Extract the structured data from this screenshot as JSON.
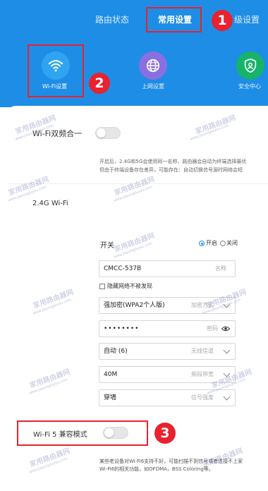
{
  "header": {
    "tabs": [
      {
        "label": "路由状态"
      },
      {
        "label": "常用设置"
      },
      {
        "label": "级设置"
      }
    ],
    "icons": [
      {
        "label": "Wi-Fi设置",
        "icon": "wifi-icon",
        "color": "#2fa4f0"
      },
      {
        "label": "上网设置",
        "icon": "globe-icon",
        "color": "#8a6fe0"
      },
      {
        "label": "安全中心",
        "icon": "shield-icon",
        "color": "#16b36a"
      }
    ]
  },
  "markers": {
    "one": "1",
    "two": "2",
    "three": "3"
  },
  "dual_band": {
    "label": "Wi-Fi双频合一",
    "enabled": false,
    "desc_line1": "开启后，2.4G和5G会使用同一名称，路由器会自动为终端选择最优",
    "desc_line2": "但由于终端设备存在差异，可能存在：自动切换信号源时网络会短"
  },
  "section_24g": {
    "title": "2.4G Wi-Fi",
    "switch_label": "开关",
    "radio_on": "开启",
    "radio_off": "关闭",
    "ssid": "CMCC-537B",
    "ssid_hint": "名称",
    "hide_label": "隐藏网络不被发现",
    "encryption": "强加密(WPA2个人版)",
    "encryption_hint": "加密方式",
    "password": "••••••••",
    "password_hint": "密码",
    "channel": "自动 (6)",
    "channel_hint": "无线信道",
    "bandwidth": "40M",
    "bandwidth_hint": "频段带宽",
    "signal": "穿墙",
    "signal_hint": "信号强度"
  },
  "compat": {
    "label": "Wi-Fi 5 兼容模式",
    "enabled": false,
    "desc_line1": "某些老设备对Wi-Fi6支持不好，可能扫描不到信号或者连接不上家",
    "desc_line2": "Wi-Fi6的相关功能，如OFDMA，BSS Coloring等。"
  },
  "watermark": {
    "logo": "家用路由器网",
    "url": "www.jiayongluyou.com"
  },
  "colors": {
    "brand_blue": "#1e8de6",
    "marker_red": "#e8222e"
  }
}
